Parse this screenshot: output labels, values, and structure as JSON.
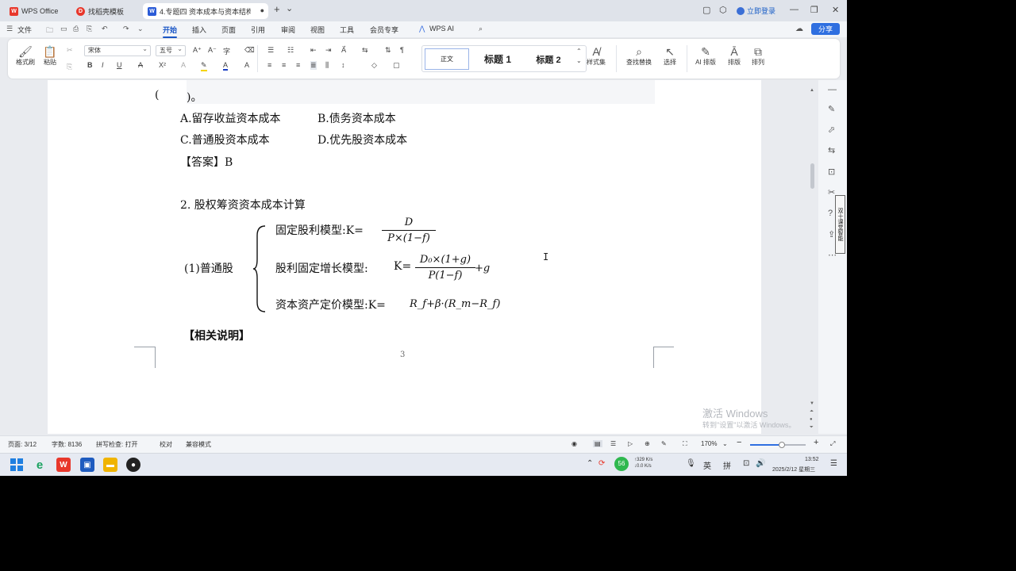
{
  "tabs": [
    {
      "label": "WPS Office",
      "icon": "wps-logo-icon",
      "color": "#e8372b"
    },
    {
      "label": "找稻壳模板",
      "icon": "docer-icon",
      "color": "#e8372b"
    },
    {
      "label": "4.专题四 资本成本与资本结构",
      "icon": "word-doc-icon",
      "color": "#2a5bd7"
    }
  ],
  "titlebar": {
    "login": "立即登录",
    "add_tab": "+",
    "tab_menu": "⌄"
  },
  "menu": {
    "file": "文件",
    "items": [
      "开始",
      "插入",
      "页面",
      "引用",
      "审阅",
      "视图",
      "工具",
      "会员专享"
    ],
    "active": "开始",
    "ai": "WPS AI",
    "share": "分享"
  },
  "ribbon": {
    "format_painter": "格式刷",
    "paste": "粘贴",
    "font_name": "宋体",
    "font_size": "五号",
    "styles": [
      "正文",
      "标题 1",
      "标题 2"
    ],
    "style_set": "样式集",
    "find_replace": "查找替换",
    "select": "选择",
    "ai_layout": "AI 排版",
    "layout": "排版",
    "arrange": "排列"
  },
  "document": {
    "line_top_open": "(",
    "line_top_close": ")。",
    "option_a": "A.留存收益资本成本",
    "option_b": "B.债务资本成本",
    "option_c": "C.普通股资本成本",
    "option_d": "D.优先股资本成本",
    "answer": "【答案】B",
    "section": "2. 股权筹资资本成本计算",
    "common_stock": "(1)普通股",
    "model1_label": "固定股利模型:K=",
    "model1_num": "D",
    "model1_den": "P×(1−f)",
    "model2_label": "股利固定增长模型:",
    "model2_k": "K=",
    "model2_num": "D₀×(1+g)",
    "model2_den": "P(1−f)",
    "model2_tail": "+g",
    "model3_label": "资本资产定价模型:K=",
    "model3_formula": "R_f+β·(R_m−R_f)",
    "related": "【相关说明】",
    "page_number": "3"
  },
  "watermark": {
    "line1": "激活 Windows",
    "line2": "转到\"设置\"以激活 Windows。"
  },
  "statusbar": {
    "page": "页面: 3/12",
    "words": "字数: 8136",
    "spell": "拼写检查: 打开",
    "proof": "校对",
    "compat": "兼容模式",
    "zoom": "170%",
    "zoom_fraction": 0.57
  },
  "taskbar": {
    "time": "13:52",
    "date": "2025/2/12 星期三",
    "ime1": "英",
    "ime2": "拼",
    "net_up": "↑329 K/s",
    "net_down": "↓0.0 K/s",
    "badge": "56"
  },
  "side_tool": "双十课堂智能"
}
